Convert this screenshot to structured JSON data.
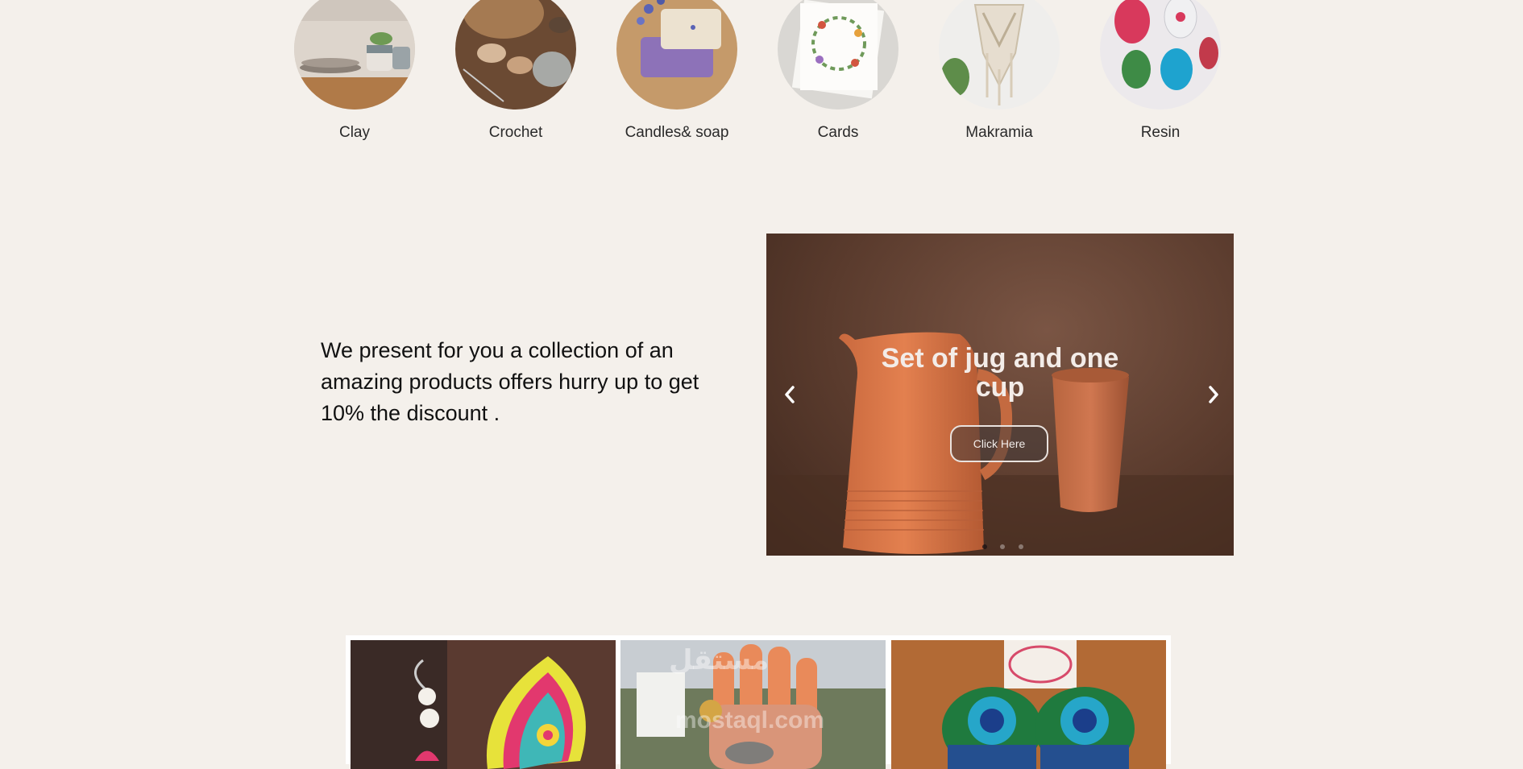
{
  "categories": [
    {
      "label": "Clay",
      "icon": "clay-tableware-image"
    },
    {
      "label": "Crochet",
      "icon": "yarn-crochet-image"
    },
    {
      "label": "Candles& soap",
      "icon": "lavender-soap-image"
    },
    {
      "label": "Cards",
      "icon": "floral-card-image"
    },
    {
      "label": "Makramia",
      "icon": "macrame-wall-hanging-image"
    },
    {
      "label": "Resin",
      "icon": "resin-earrings-image"
    }
  ],
  "promo": {
    "text": "We present for you a collection of an amazing products offers hurry up to get 10% the discount ."
  },
  "slider": {
    "title_line1": "Set of jug and one",
    "title_line2": "cup",
    "button_label": "Click Here",
    "prev_icon": "chevron-left-icon",
    "next_icon": "chevron-right-icon",
    "slide_count": 3,
    "active_slide": 1
  },
  "gallery": {
    "items": [
      "crochet-earrings-image",
      "nail-ring-image",
      "peacock-earrings-image"
    ],
    "watermark_ar": "مستقل",
    "watermark_en": "mostaql.com"
  },
  "colors": {
    "background": "#f4f0eb",
    "slider_bg": "#5a3b2d",
    "terracotta": "#d9774a"
  }
}
